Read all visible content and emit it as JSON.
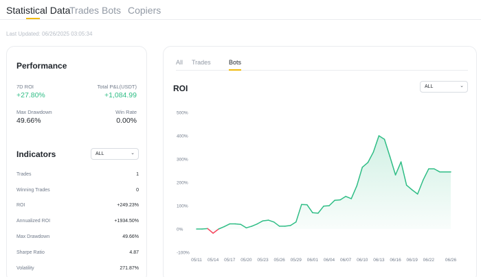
{
  "tabs": [
    {
      "label": "Statistical Data",
      "active": true
    },
    {
      "label": "Trades",
      "active": false
    },
    {
      "label": "Bots",
      "active": false
    },
    {
      "label": "Copiers",
      "active": false
    }
  ],
  "last_updated": "Last Updated: 06/26/2025 03:05:34",
  "performance": {
    "title": "Performance",
    "roi_7d_label": "7D ROI",
    "roi_7d_value": "+27.80%",
    "pnl_label": "Total P&L(USDT)",
    "pnl_value": "+1,084.99",
    "drawdown_label": "Max Drawdown",
    "drawdown_value": "49.66%",
    "winrate_label": "Win Rate",
    "winrate_value": "0.00%"
  },
  "indicators": {
    "title": "Indicators",
    "filter": "ALL",
    "rows": [
      {
        "label": "Trades",
        "value": "1"
      },
      {
        "label": "Winning Trades",
        "value": "0"
      },
      {
        "label": "ROI",
        "value": "+249.23%"
      },
      {
        "label": "Annualized ROI",
        "value": "+1934.50%"
      },
      {
        "label": "Max Drawdown",
        "value": "49.66%"
      },
      {
        "label": "Sharpe Ratio",
        "value": "4.87"
      },
      {
        "label": "Volatility",
        "value": "271.87%"
      }
    ]
  },
  "roi_panel": {
    "sub_tabs": [
      {
        "label": "All",
        "active": false
      },
      {
        "label": "Trades",
        "active": false
      },
      {
        "label": "Bots",
        "active": true
      }
    ],
    "title": "ROI",
    "filter": "ALL"
  },
  "colors": {
    "accent": "#f0b90b",
    "positive": "#2ebd85",
    "negative": "#f6465d"
  },
  "icons": {
    "dropdown": "chevron-down-icon"
  },
  "chart_data": {
    "type": "area",
    "title": "ROI",
    "xlabel": "",
    "ylabel": "",
    "x_tick_labels": [
      "05/11",
      "05/14",
      "05/17",
      "05/20",
      "05/23",
      "05/26",
      "05/29",
      "06/01",
      "06/04",
      "06/07",
      "06/10",
      "06/13",
      "06/16",
      "06/19",
      "06/22",
      "06/26"
    ],
    "y_tick_labels": [
      "-100%",
      "0%",
      "100%",
      "200%",
      "300%",
      "400%",
      "500%"
    ],
    "ylim": [
      -100,
      500
    ],
    "grid": false,
    "y_unit": "%",
    "series": [
      {
        "x": [
          "05/11",
          "05/12",
          "05/13",
          "05/14",
          "05/15",
          "05/16",
          "05/17",
          "05/18",
          "05/19",
          "05/20",
          "05/21",
          "05/22",
          "05/23",
          "05/24",
          "05/25",
          "05/26",
          "05/27",
          "05/28",
          "05/29",
          "05/30",
          "05/31",
          "06/01",
          "06/02",
          "06/03",
          "06/04",
          "06/05",
          "06/06",
          "06/07",
          "06/08",
          "06/09",
          "06/10",
          "06/11",
          "06/12",
          "06/13",
          "06/14",
          "06/15",
          "06/16",
          "06/17",
          "06/18",
          "06/19",
          "06/20",
          "06/21",
          "06/22",
          "06/23",
          "06/24",
          "06/25",
          "06/26"
        ],
        "values": [
          0,
          0,
          2,
          -18,
          0,
          10,
          22,
          22,
          20,
          5,
          12,
          22,
          35,
          38,
          30,
          12,
          12,
          15,
          30,
          105,
          104,
          70,
          68,
          98,
          100,
          123,
          125,
          140,
          130,
          185,
          265,
          285,
          330,
          400,
          385,
          310,
          232,
          288,
          188,
          168,
          150,
          210,
          258,
          258,
          245,
          245,
          245
        ]
      }
    ]
  }
}
